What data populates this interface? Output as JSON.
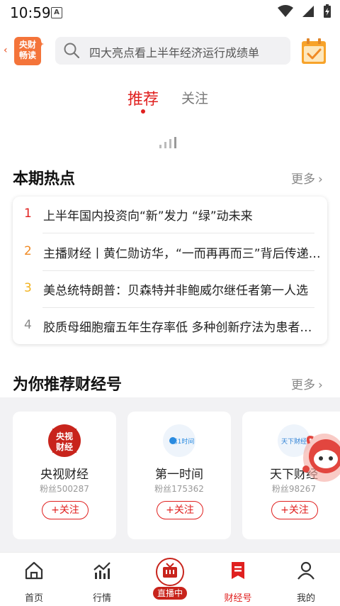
{
  "status_bar": {
    "time": "10:59",
    "notification_glyph": "A"
  },
  "header": {
    "logo_text_line1": "央财",
    "logo_text_line2": "畅读",
    "search_placeholder": "四大亮点看上半年经济运行成绩单",
    "icons": [
      "back-arrow-icon",
      "search-icon",
      "calendar-check-icon"
    ]
  },
  "tabs": [
    {
      "label": "推荐",
      "active": true
    },
    {
      "label": "关注",
      "active": false
    }
  ],
  "hot": {
    "title": "本期热点",
    "more": "更多",
    "items": [
      {
        "rank": "1",
        "rank_color": "#e0201f",
        "text": "上半年国内投资向“新”发力 “绿”动未来"
      },
      {
        "rank": "2",
        "rank_color": "#f08a24",
        "text": "主播财经丨黄仁勋访华，“一而再再而三”背后传递出..."
      },
      {
        "rank": "3",
        "rank_color": "#f2b21e",
        "text": "美总统特朗普：贝森特并非鲍威尔继任者第一人选"
      },
      {
        "rank": "4",
        "rank_color": "#888888",
        "text": "胶质母细胞瘤五年生存率低 多种创新疗法为患者带来..."
      }
    ]
  },
  "recommend": {
    "title": "为你推荐财经号",
    "more": "更多",
    "accounts": [
      {
        "name": "央视财经",
        "fans": "粉丝500287",
        "follow": "+关注",
        "logo_text": "央视财经"
      },
      {
        "name": "第一时间",
        "fans": "粉丝175362",
        "follow": "+关注",
        "logo_text": "第1时间"
      },
      {
        "name": "天下财经",
        "fans": "粉丝98267",
        "follow": "+关注",
        "logo_text": "天下财经"
      }
    ]
  },
  "bottom_nav": [
    {
      "label": "首页",
      "icon": "home-icon",
      "active": false
    },
    {
      "label": "行情",
      "icon": "market-chart-icon",
      "active": false
    },
    {
      "label": "直播中",
      "icon": "live-tv-icon",
      "active": false
    },
    {
      "label": "财经号",
      "icon": "finance-account-icon",
      "active": true
    },
    {
      "label": "我的",
      "icon": "profile-icon",
      "active": false
    }
  ],
  "colors": {
    "accent": "#e0201f",
    "orange": "#f4743a"
  }
}
